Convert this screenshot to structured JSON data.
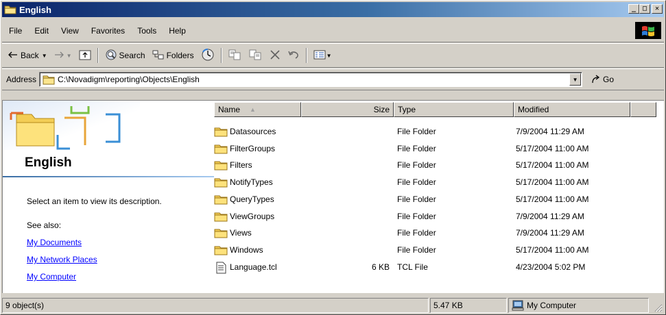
{
  "window": {
    "title": "English",
    "minimize": "_",
    "maximize": "□",
    "close": "✕"
  },
  "menu": [
    "File",
    "Edit",
    "View",
    "Favorites",
    "Tools",
    "Help"
  ],
  "toolbar": {
    "back_label": "Back",
    "search_label": "Search",
    "folders_label": "Folders"
  },
  "address": {
    "label": "Address",
    "value": "C:\\Novadigm\\reporting\\Objects\\English",
    "go_label": "Go"
  },
  "left_pane": {
    "folder_title": "English",
    "description": "Select an item to view its description.",
    "see_also": "See also:",
    "links": [
      "My Documents",
      "My Network Places",
      "My Computer"
    ]
  },
  "columns": {
    "name": "Name",
    "size": "Size",
    "type": "Type",
    "modified": "Modified"
  },
  "files": [
    {
      "name": "Datasources",
      "size": "",
      "type": "File Folder",
      "modified": "7/9/2004 11:29 AM",
      "icon": "folder-icon"
    },
    {
      "name": "FilterGroups",
      "size": "",
      "type": "File Folder",
      "modified": "5/17/2004 11:00 AM",
      "icon": "folder-icon"
    },
    {
      "name": "Filters",
      "size": "",
      "type": "File Folder",
      "modified": "5/17/2004 11:00 AM",
      "icon": "folder-icon"
    },
    {
      "name": "NotifyTypes",
      "size": "",
      "type": "File Folder",
      "modified": "5/17/2004 11:00 AM",
      "icon": "folder-icon"
    },
    {
      "name": "QueryTypes",
      "size": "",
      "type": "File Folder",
      "modified": "5/17/2004 11:00 AM",
      "icon": "folder-icon"
    },
    {
      "name": "ViewGroups",
      "size": "",
      "type": "File Folder",
      "modified": "7/9/2004 11:29 AM",
      "icon": "folder-icon"
    },
    {
      "name": "Views",
      "size": "",
      "type": "File Folder",
      "modified": "7/9/2004 11:29 AM",
      "icon": "folder-icon"
    },
    {
      "name": "Windows",
      "size": "",
      "type": "File Folder",
      "modified": "5/17/2004 11:00 AM",
      "icon": "folder-icon"
    },
    {
      "name": "Language.tcl",
      "size": "6 KB",
      "type": "TCL File",
      "modified": "4/23/2004 5:02 PM",
      "icon": "text-file-icon"
    }
  ],
  "status": {
    "objects": "9 object(s)",
    "size": "5.47 KB",
    "zone": "My Computer"
  },
  "colors": {
    "title_start": "#0a246a",
    "title_end": "#a6caf0",
    "chrome": "#d4d0c8",
    "link": "#0000ff"
  }
}
